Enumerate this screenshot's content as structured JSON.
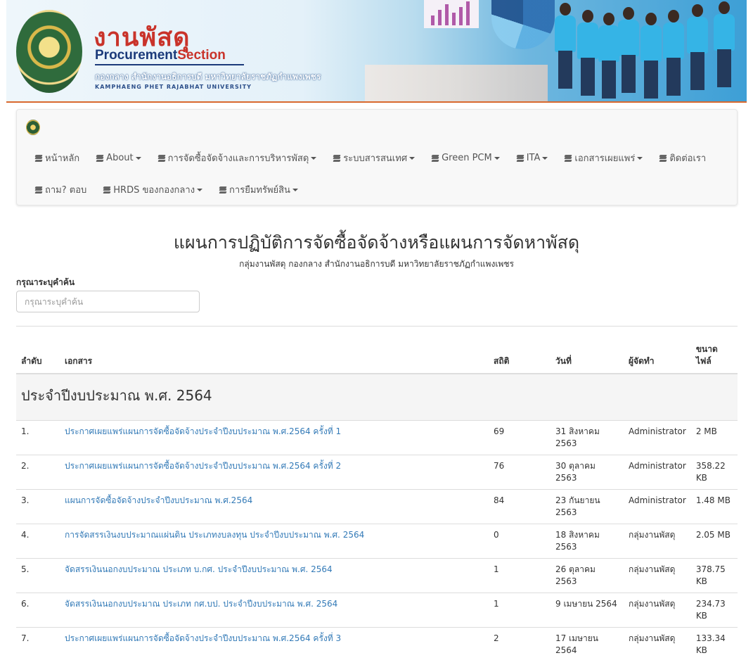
{
  "banner": {
    "title_th": "งานพัสดุ",
    "title_en_a": "Procurement",
    "title_en_b": "Section",
    "subtitle_th": "กองกลาง สำนักงานอธิการบดี มหาวิทยาลัยราชภัฏกำแพงเพชร",
    "subtitle_en": "KAMPHAENG PHET RAJABHAT UNIVERSITY"
  },
  "nav": {
    "row1": [
      {
        "label": "หน้าหลัก",
        "dropdown": false
      },
      {
        "label": "About",
        "dropdown": true
      },
      {
        "label": "การจัดซื้อจัดจ้างและการบริหารพัสดุ",
        "dropdown": true
      },
      {
        "label": "ระบบสารสนเทศ",
        "dropdown": true
      },
      {
        "label": "Green PCM",
        "dropdown": true
      },
      {
        "label": "ITA",
        "dropdown": true
      },
      {
        "label": "เอกสารเผยแพร่",
        "dropdown": true
      },
      {
        "label": "ติดต่อเรา",
        "dropdown": false
      }
    ],
    "row2": [
      {
        "label": "ถาม? ตอบ",
        "dropdown": false
      },
      {
        "label": "HRDS ของกองกลาง",
        "dropdown": true
      },
      {
        "label": "การยืมทรัพย์สิน",
        "dropdown": true
      }
    ]
  },
  "page": {
    "title": "แผนการปฏิบัติการจัดซื้อจัดจ้างหรือแผนการจัดหาพัสดุ",
    "subtitle": "กลุ่มงานพัสดุ กองกลาง สำนักงานอธิการบดี มหาวิทยาลัยราชภัฏกำแพงเพชร"
  },
  "search": {
    "label": "กรุณาระบุคำค้น",
    "placeholder": "กรุณาระบุคำค้น"
  },
  "table": {
    "headers": {
      "no": "ลำดับ",
      "doc": "เอกสาร",
      "stat": "สถิติ",
      "date": "วันที่",
      "by": "ผู้จัดทำ",
      "size": "ขนาด ไฟล์"
    },
    "group": "ประจำปีงบประมาณ พ.ศ. 2564",
    "rows": [
      {
        "no": "1.",
        "doc": "ประกาศเผยแพร่แผนการจัดซื้อจัดจ้างประจำปีงบประมาณ พ.ศ.2564 ครั้งที่ 1",
        "stat": "69",
        "date": "31 สิงหาคม 2563",
        "by": "Administrator",
        "size": "2 MB"
      },
      {
        "no": "2.",
        "doc": "ประกาศเผยแพร่แผนการจัดซื้อจัดจ้างประจำปีงบประมาณ พ.ศ.2564 ครั้งที่ 2",
        "stat": "76",
        "date": "30 ตุลาคม 2563",
        "by": "Administrator",
        "size": "358.22 KB"
      },
      {
        "no": "3.",
        "doc": "แผนการจัดซื้อจัดจ้างประจำปีงบประมาณ พ.ศ.2564",
        "stat": "84",
        "date": "23 กันยายน 2563",
        "by": "Administrator",
        "size": "1.48 MB"
      },
      {
        "no": "4.",
        "doc": "การจัดสรรเงินงบประมาณแผ่นดิน ประเภทงบลงทุน ประจำปีงบประมาณ พ.ศ. 2564",
        "stat": "0",
        "date": "18 สิงหาคม 2563",
        "by": "กลุ่มงานพัสดุ",
        "size": "2.05 MB"
      },
      {
        "no": "5.",
        "doc": "จัดสรรเงินนอกงบประมาณ ประเภท บ.กศ. ประจำปีงบประมาณ พ.ศ. 2564",
        "stat": "1",
        "date": "26 ตุลาคม 2563",
        "by": "กลุ่มงานพัสดุ",
        "size": "378.75 KB"
      },
      {
        "no": "6.",
        "doc": "จัดสรรเงินนอกงบประมาณ ประเภท กศ.บป. ประจำปีงบประมาณ พ.ศ. 2564",
        "stat": "1",
        "date": "9 เมษายน 2564",
        "by": "กลุ่มงานพัสดุ",
        "size": "234.73 KB"
      },
      {
        "no": "7.",
        "doc": "ประกาศเผยแพร่แผนการจัดซื้อจัดจ้างประจำปีงบประมาณ พ.ศ.2564 ครั้งที่ 3",
        "stat": "2",
        "date": "17 เมษายน 2564",
        "by": "กลุ่มงานพัสดุ",
        "size": "133.34 KB"
      }
    ]
  },
  "colors": {
    "link": "#337ab7",
    "brand_red": "#c9332a",
    "brand_blue": "#1b3a7a",
    "banner_accent": "#d9692e"
  },
  "icons": {
    "nav_item": "stack-icon",
    "dropdown": "caret-down-icon"
  }
}
